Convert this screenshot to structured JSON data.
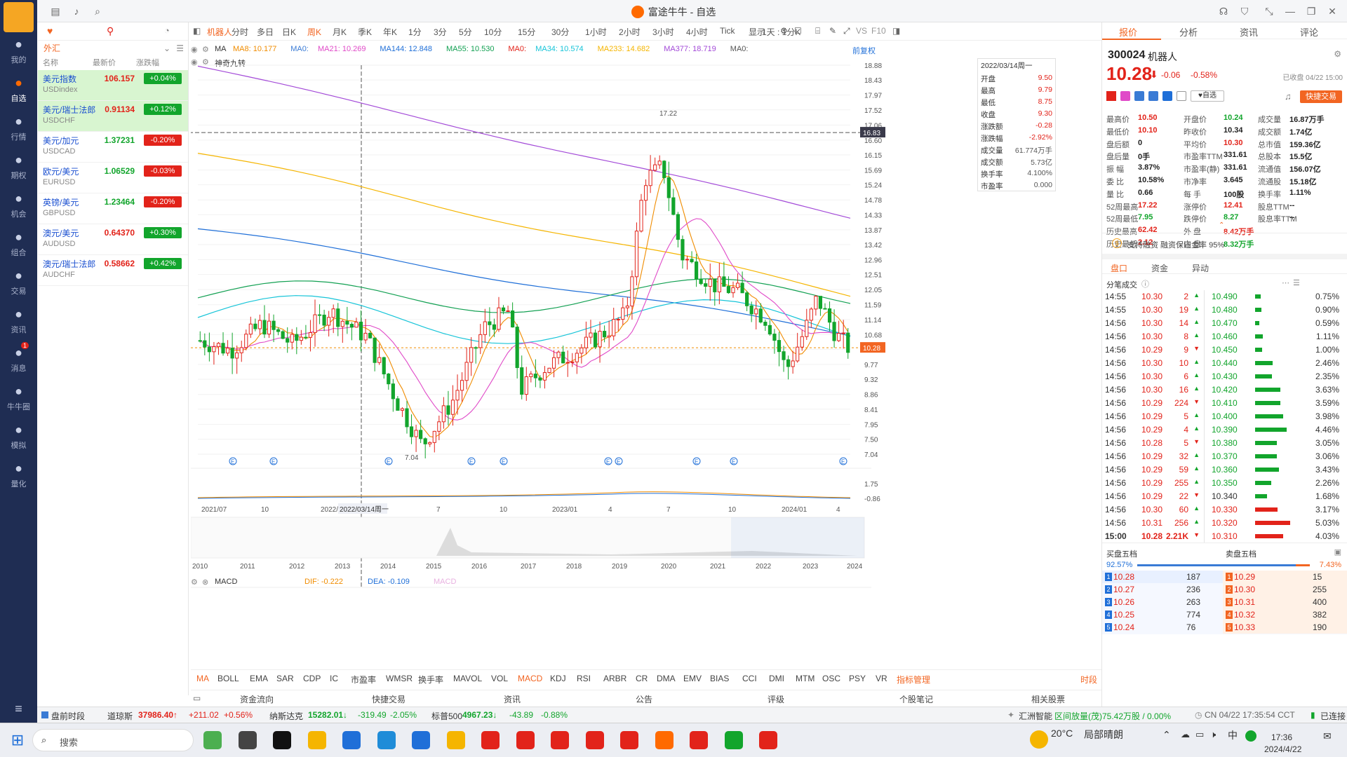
{
  "window": {
    "title": "富途牛牛 - 自选"
  },
  "nav": [
    {
      "label": "我的",
      "icon": "user-icon"
    },
    {
      "label": "自选",
      "icon": "watchlist-icon"
    },
    {
      "label": "行情",
      "icon": "market-icon"
    },
    {
      "label": "期权",
      "icon": "options-icon"
    },
    {
      "label": "机会",
      "icon": "opportunity-icon"
    },
    {
      "label": "组合",
      "icon": "portfolio-icon"
    },
    {
      "label": "交易",
      "icon": "trade-icon"
    },
    {
      "label": "资讯",
      "icon": "news-icon"
    },
    {
      "label": "消息",
      "icon": "message-icon",
      "badge": "1"
    },
    {
      "label": "牛牛圈",
      "icon": "community-icon"
    },
    {
      "label": "模拟",
      "icon": "simulate-icon"
    },
    {
      "label": "量化",
      "icon": "quant-icon"
    }
  ],
  "watchlist": {
    "category": "外汇",
    "headers": [
      "名称",
      "最新价",
      "涨跌幅"
    ],
    "rows": [
      {
        "name": "美元指数",
        "code": "USDindex",
        "price": "106.157",
        "change": "+0.04%",
        "dir": "up"
      },
      {
        "name": "美元/瑞士法郎",
        "code": "USDCHF",
        "price": "0.91134",
        "change": "+0.12%",
        "dir": "up"
      },
      {
        "name": "美元/加元",
        "code": "USDCAD",
        "price": "1.37231",
        "change": "-0.20%",
        "dir": "dn"
      },
      {
        "name": "欧元/美元",
        "code": "EURUSD",
        "price": "1.06529",
        "change": "-0.03%",
        "dir": "dn"
      },
      {
        "name": "英镑/美元",
        "code": "GBPUSD",
        "price": "1.23464",
        "change": "-0.20%",
        "dir": "dn"
      },
      {
        "name": "澳元/美元",
        "code": "AUDUSD",
        "price": "0.64370",
        "change": "+0.30%",
        "dir": "up"
      },
      {
        "name": "澳元/瑞士法郎",
        "code": "AUDCHF",
        "price": "0.58662",
        "change": "+0.42%",
        "dir": "up"
      }
    ]
  },
  "toolbar": {
    "stock": "机器人",
    "periods": [
      "分时",
      "多日",
      "日K",
      "周K",
      "月K",
      "季K",
      "年K",
      "1分",
      "3分",
      "5分",
      "10分",
      "15分",
      "30分",
      "1小时",
      "2小时",
      "3小时",
      "4小时",
      "Tick",
      "1天 : 1分K"
    ],
    "active": "周K",
    "display": "显示",
    "vs": "VS",
    "f10": "F10"
  },
  "ma": {
    "label": "MA",
    "items": [
      {
        "t": "MA8: 10.177",
        "c": "#f08c00"
      },
      {
        "t": "MA0:",
        "c": "#3a7bd5"
      },
      {
        "t": "MA21: 10.269",
        "c": "#e04ac8"
      },
      {
        "t": "MA144: 12.848",
        "c": "#1f6fd8"
      },
      {
        "t": "MA55: 10.530",
        "c": "#12a052"
      },
      {
        "t": "MA0:",
        "c": "#e2231a"
      },
      {
        "t": "MA34: 10.574",
        "c": "#16c4d8"
      },
      {
        "t": "MA233: 14.682",
        "c": "#f5b500"
      },
      {
        "t": "MA377: 18.719",
        "c": "#a34ad8"
      },
      {
        "t": "MA0:",
        "c": "#555"
      }
    ],
    "restore": "前复权",
    "indicator": "神奇九转"
  },
  "tooltip": {
    "date": "2022/03/14周一",
    "rows": [
      [
        "开盘",
        "9.50",
        "up"
      ],
      [
        "最高",
        "9.79",
        "up"
      ],
      [
        "最低",
        "8.75",
        "up"
      ],
      [
        "收盘",
        "9.30",
        "up"
      ],
      [
        "涨跌额",
        "-0.28",
        "up"
      ],
      [
        "涨跌幅",
        "-2.92%",
        "up"
      ],
      [
        "成交量",
        "61.774万手",
        ""
      ],
      [
        "成交额",
        "5.73亿",
        ""
      ],
      [
        "换手率",
        "4.100%",
        ""
      ],
      [
        "市盈率",
        "0.000",
        ""
      ]
    ]
  },
  "macd": {
    "label": "MACD",
    "dif": "DIF: -0.222",
    "dea": "DEA: -0.109",
    "macd": "MACD"
  },
  "chart_data": {
    "type": "candlestick",
    "yticks": [
      "18.88",
      "18.43",
      "17.97",
      "17.52",
      "17.06",
      "16.60",
      "16.15",
      "15.69",
      "15.24",
      "14.78",
      "14.33",
      "13.87",
      "13.42",
      "12.96",
      "12.51",
      "12.05",
      "11.59",
      "11.14",
      "10.68",
      "10.23",
      "9.77",
      "9.32",
      "8.86",
      "8.41",
      "7.95",
      "7.50",
      "7.04"
    ],
    "ylim": [
      7.04,
      18.88
    ],
    "xticks": [
      "2021/07",
      "10",
      "2022/",
      "7",
      "10",
      "2023/01",
      "4",
      "7",
      "10",
      "2024/01",
      "4"
    ],
    "cursor_date": "2022/03/14周一",
    "cursor_price": "16.83",
    "last_price": "10.28",
    "high_label": "17.22",
    "low_label": "7.04",
    "macd_yticks": [
      "1.75",
      "-0.86"
    ],
    "overview_years": [
      "2010",
      "2011",
      "2012",
      "2013",
      "2014",
      "2015",
      "2016",
      "2017",
      "2018",
      "2019",
      "2020",
      "2021",
      "2022",
      "2023",
      "2024"
    ]
  },
  "indicators": [
    "MA",
    "BOLL",
    "EMA",
    "SAR",
    "CDP",
    "IC",
    "市盈率",
    "WMSR",
    "换手率",
    "MAVOL",
    "VOL",
    "MACD",
    "KDJ",
    "RSI",
    "ARBR",
    "CR",
    "DMA",
    "EMV",
    "BIAS",
    "CCI",
    "DMI",
    "MTM",
    "OSC",
    "PSY",
    "VR",
    "指标管理"
  ],
  "indicators_right": "时段",
  "bottom_tabs": [
    "资金流向",
    "快捷交易",
    "资讯",
    "公告",
    "评级",
    "个股笔记",
    "相关股票"
  ],
  "quote": {
    "tabs": [
      "报价",
      "分析",
      "资讯",
      "评论"
    ],
    "code": "300024",
    "name": "机器人",
    "price": "10.28",
    "change": "-0.06",
    "pct": "-0.58%",
    "closed": "已收盘 04/22 15:00",
    "watch": "自选",
    "fast": "快捷交易",
    "fields": [
      [
        "最高价",
        "10.50",
        "up"
      ],
      [
        "开盘价",
        "10.24",
        "dn"
      ],
      [
        "成交量",
        "16.87万手",
        ""
      ],
      [
        "最低价",
        "10.10",
        "up"
      ],
      [
        "昨收价",
        "10.34",
        ""
      ],
      [
        "成交额",
        "1.74亿",
        ""
      ],
      [
        "盘后额",
        "0",
        ""
      ],
      [
        "平均价",
        "10.30",
        "up"
      ],
      [
        "总市值",
        "159.36亿",
        ""
      ],
      [
        "盘后量",
        "0手",
        ""
      ],
      [
        "市盈率TTM",
        "331.61",
        ""
      ],
      [
        "总股本",
        "15.5亿",
        ""
      ],
      [
        "振  幅",
        "3.87%",
        ""
      ],
      [
        "市盈率(静)",
        "331.61",
        ""
      ],
      [
        "流通值",
        "156.07亿",
        ""
      ],
      [
        "委  比",
        "10.58%",
        ""
      ],
      [
        "市净率",
        "3.645",
        ""
      ],
      [
        "流通股",
        "15.18亿",
        ""
      ],
      [
        "量  比",
        "0.66",
        ""
      ],
      [
        "每  手",
        "100股",
        ""
      ],
      [
        "换手率",
        "1.11%",
        ""
      ],
      [
        "52周最高",
        "17.22",
        "up"
      ],
      [
        "涨停价",
        "12.41",
        "up"
      ],
      [
        "股息TTM",
        "--",
        ""
      ],
      [
        "52周最低",
        "7.95",
        "dn"
      ],
      [
        "跌停价",
        "8.27",
        "dn"
      ],
      [
        "股息率TTM",
        "--",
        ""
      ],
      [
        "历史最高",
        "62.42",
        "up"
      ],
      [
        "外  盘",
        "8.42万手",
        "up"
      ],
      [
        "",
        "",
        " "
      ],
      [
        "历史最低",
        "2.12",
        "up"
      ],
      [
        "内  盘",
        "8.32万手",
        "dn"
      ],
      [
        "",
        "",
        " "
      ]
    ],
    "margin": "支持融资 融资保证金率 95%",
    "subtabs": [
      "盘口",
      "资金",
      "异动"
    ],
    "ticks_title": "分笔成交",
    "ticks": [
      [
        "14:55",
        "10.30",
        "2",
        "up"
      ],
      [
        "14:55",
        "10.30",
        "19",
        "up"
      ],
      [
        "14:56",
        "10.30",
        "14",
        "up"
      ],
      [
        "14:56",
        "10.30",
        "8",
        "up"
      ],
      [
        "14:56",
        "10.29",
        "9",
        "dn"
      ],
      [
        "14:56",
        "10.30",
        "10",
        "up"
      ],
      [
        "14:56",
        "10.30",
        "6",
        "up"
      ],
      [
        "14:56",
        "10.30",
        "16",
        "up"
      ],
      [
        "14:56",
        "10.29",
        "224",
        "dn"
      ],
      [
        "14:56",
        "10.29",
        "5",
        "up"
      ],
      [
        "14:56",
        "10.29",
        "4",
        "up"
      ],
      [
        "14:56",
        "10.28",
        "5",
        "dn"
      ],
      [
        "14:56",
        "10.29",
        "32",
        "up"
      ],
      [
        "14:56",
        "10.29",
        "59",
        "up"
      ],
      [
        "14:56",
        "10.29",
        "255",
        "up"
      ],
      [
        "14:56",
        "10.29",
        "22",
        "dn"
      ],
      [
        "14:56",
        "10.30",
        "60",
        "up"
      ],
      [
        "14:56",
        "10.31",
        "256",
        "up"
      ],
      [
        "15:00",
        "10.28",
        "2.21K",
        "dn"
      ]
    ],
    "depth": [
      [
        "10.490",
        "0.75%"
      ],
      [
        "10.480",
        "0.90%"
      ],
      [
        "10.470",
        "0.59%"
      ],
      [
        "10.460",
        "1.11%"
      ],
      [
        "10.450",
        "1.00%"
      ],
      [
        "10.440",
        "2.46%"
      ],
      [
        "10.430",
        "2.35%"
      ],
      [
        "10.420",
        "3.63%"
      ],
      [
        "10.410",
        "3.59%"
      ],
      [
        "10.400",
        "3.98%"
      ],
      [
        "10.390",
        "4.46%"
      ],
      [
        "10.380",
        "3.05%"
      ],
      [
        "10.370",
        "3.06%"
      ],
      [
        "10.360",
        "3.43%"
      ],
      [
        "10.350",
        "2.26%"
      ],
      [
        "10.340",
        "1.68%"
      ],
      [
        "10.330",
        "3.17%"
      ],
      [
        "10.320",
        "5.03%"
      ],
      [
        "10.310",
        "4.03%"
      ]
    ],
    "book_buy_title": "买盘五档",
    "book_sell_title": "卖盘五档",
    "buy_ratio": "92.57%",
    "sell_ratio": "7.43%",
    "bids": [
      [
        "1",
        "10.28",
        "187"
      ],
      [
        "2",
        "10.27",
        "236"
      ],
      [
        "3",
        "10.26",
        "263"
      ],
      [
        "4",
        "10.25",
        "774"
      ],
      [
        "5",
        "10.24",
        "76"
      ]
    ],
    "asks": [
      [
        "1",
        "10.29",
        "15"
      ],
      [
        "2",
        "10.30",
        "255"
      ],
      [
        "3",
        "10.31",
        "400"
      ],
      [
        "4",
        "10.32",
        "382"
      ],
      [
        "5",
        "10.33",
        "190"
      ]
    ]
  },
  "status": {
    "premarket": "盘前时段",
    "dow_name": "道琼斯",
    "dow": "37986.40↑",
    "dow_c": "+211.02",
    "dow_p": "+0.56%",
    "nas_name": "纳斯达克",
    "nas": "15282.01↓",
    "nas_c": "-319.49",
    "nas_p": "-2.05%",
    "sp_name": "标普500",
    "sp": "4967.23↓",
    "sp_c": "-43.89",
    "sp_p": "-0.88%",
    "broker": "汇洲智能",
    "zone": "区间放量(茂)",
    "zone_v": "75.42万股 / 0.00%",
    "time": "CN 04/22 17:35:54 CCT",
    "conn": "已连接"
  },
  "taskbar": {
    "search": "搜索",
    "weather": "20°C",
    "weather_desc": "局部晴朗",
    "clock": "17:36",
    "date": "2024/4/22",
    "ime": "中"
  }
}
